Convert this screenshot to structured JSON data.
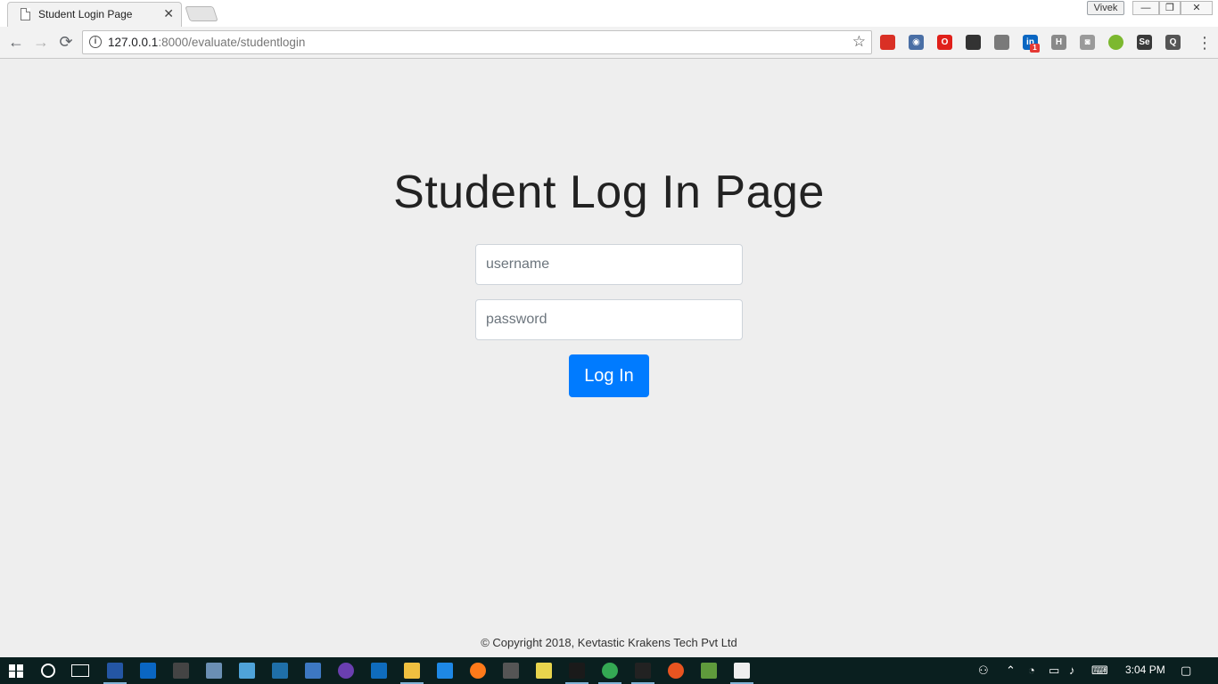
{
  "browser": {
    "tab_title": "Student Login Page",
    "tab_close": "✕",
    "user_name": "Vivek",
    "window_buttons": {
      "minimize": "—",
      "maximize": "❐",
      "close": "✕"
    },
    "url_host": "127.0.0.1",
    "url_rest": ":8000/evaluate/studentlogin",
    "nav": {
      "back": "←",
      "forward": "→",
      "reload": "⟳"
    },
    "extensions": [
      {
        "name": "bookmark-ext-icon",
        "color": "#d93025",
        "label": ""
      },
      {
        "name": "circle-ext-icon",
        "color": "#4a6fa5",
        "label": "◉"
      },
      {
        "name": "opera-ext-icon",
        "color": "#e0201a",
        "label": "O"
      },
      {
        "name": "tool-ext-icon",
        "color": "#333333",
        "label": ""
      },
      {
        "name": "note-ext-icon",
        "color": "#7a7a7a",
        "label": ""
      },
      {
        "name": "linkedin-ext-icon",
        "color": "#0a66c2",
        "label": "in",
        "badge": "1"
      },
      {
        "name": "h-ext-icon",
        "color": "#8a8a8a",
        "label": "H"
      },
      {
        "name": "camera-ext-icon",
        "color": "#9a9a9a",
        "label": "◙"
      },
      {
        "name": "green-dot-ext-icon",
        "color": "#7cb82f",
        "label": ""
      },
      {
        "name": "selenium-ext-icon",
        "color": "#3a3a3a",
        "label": "Se"
      },
      {
        "name": "bulb-ext-icon",
        "color": "#555555",
        "label": "Q"
      }
    ]
  },
  "page": {
    "heading": "Student Log In Page",
    "username_placeholder": "username",
    "password_placeholder": "password",
    "login_label": "Log In",
    "footer": "© Copyright 2018, Kevtastic Krakens Tech Pvt Ltd"
  },
  "taskbar": {
    "clock": "3:04 PM",
    "apps": [
      {
        "name": "powershell-icon",
        "color": "#2456a4"
      },
      {
        "name": "linkedin-app-icon",
        "color": "#0a66c2"
      },
      {
        "name": "calculator-icon",
        "color": "#444444"
      },
      {
        "name": "network-app-icon",
        "color": "#6b8fb3"
      },
      {
        "name": "box-app-icon",
        "color": "#4fa3d9"
      },
      {
        "name": "mysql-icon",
        "color": "#1f6fa8"
      },
      {
        "name": "keyboard-app-icon",
        "color": "#3d78c2"
      },
      {
        "name": "github-icon",
        "color": "#6a3fb0"
      },
      {
        "name": "outlook-icon",
        "color": "#0f6cbd"
      },
      {
        "name": "file-explorer-icon",
        "color": "#f0c040"
      },
      {
        "name": "vscode-icon",
        "color": "#1e88e5"
      },
      {
        "name": "firefox-icon",
        "color": "#ff7a1a"
      },
      {
        "name": "terminal-app-icon",
        "color": "#555555"
      },
      {
        "name": "notepad-icon",
        "color": "#e8d44d"
      },
      {
        "name": "pycharm-icon",
        "color": "#1a1a1a"
      },
      {
        "name": "chrome-icon",
        "color": "#34a853"
      },
      {
        "name": "cmd-icon",
        "color": "#222222"
      },
      {
        "name": "ubuntu-icon",
        "color": "#e95420"
      },
      {
        "name": "git-icon",
        "color": "#5f9a3c"
      },
      {
        "name": "settings-icon",
        "color": "#eeeeee"
      }
    ]
  }
}
